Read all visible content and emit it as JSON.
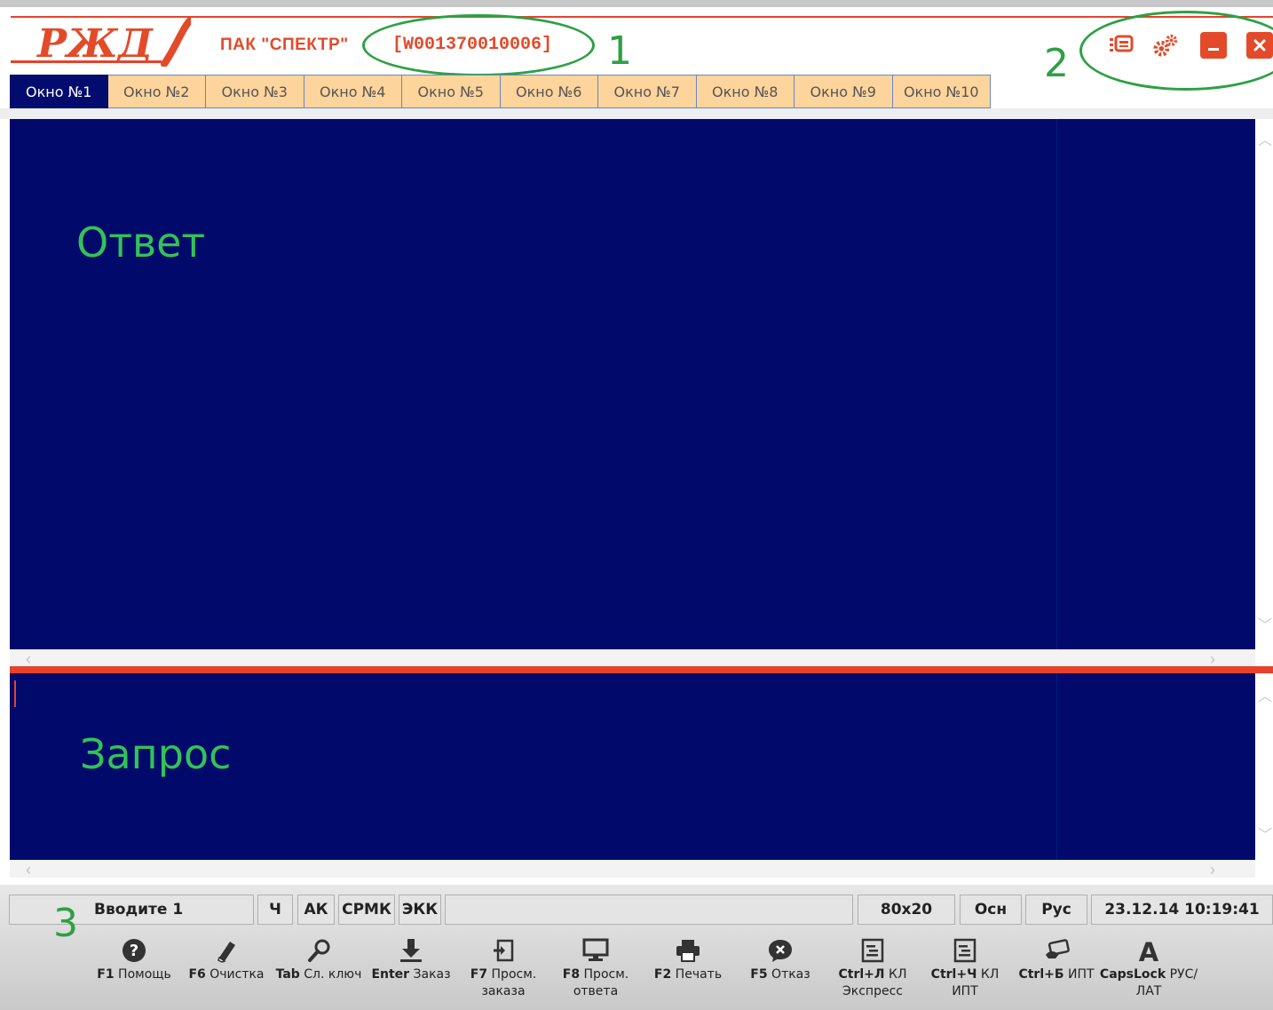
{
  "header": {
    "app_title": "ПАК \"СПЕКТР\"",
    "station_id": "[W001370010006]",
    "logo_text": "РЖД"
  },
  "annotations": [
    "1",
    "2",
    "3"
  ],
  "header_buttons": [
    {
      "name": "window-list-icon",
      "color": "#e34a2a"
    },
    {
      "name": "gears-icon",
      "color": "#e34a2a"
    },
    {
      "name": "minimize-icon",
      "color": "#e34a2a"
    },
    {
      "name": "close-icon",
      "color": "#e34a2a"
    }
  ],
  "tabs": [
    {
      "label": "Окно №1",
      "active": true
    },
    {
      "label": "Окно №2"
    },
    {
      "label": "Окно №3"
    },
    {
      "label": "Окно №4"
    },
    {
      "label": "Окно №5"
    },
    {
      "label": "Окно №6"
    },
    {
      "label": "Окно №7"
    },
    {
      "label": "Окно №8"
    },
    {
      "label": "Окно №9"
    },
    {
      "label": "Окно №10"
    }
  ],
  "panels": {
    "answer_label": "Ответ",
    "request_label": "Запрос"
  },
  "status_bar": {
    "input_status": "Вводите 1",
    "flag_ch": "Ч",
    "flag_ak": "АК",
    "flag_srmk": "СРМК",
    "flag_ekk": "ЭКК",
    "empty_field": "",
    "screen_size": "80x20",
    "mode": "Осн",
    "language": "Рус",
    "datetime": "23.12.14 10:19:41"
  },
  "function_keys": [
    {
      "key": "F1",
      "label": "Помощь",
      "label2": "",
      "icon": "help-icon"
    },
    {
      "key": "F6",
      "label": "Очистка",
      "label2": "",
      "icon": "eraser-icon"
    },
    {
      "key": "Tab",
      "label": "Сл. ключ",
      "label2": "",
      "icon": "search-key-icon"
    },
    {
      "key": "Enter",
      "label": "Заказ",
      "label2": "",
      "icon": "download-icon"
    },
    {
      "key": "F7",
      "label": "Просм.",
      "label2": "заказа",
      "icon": "view-order-icon"
    },
    {
      "key": "F8",
      "label": "Просм.",
      "label2": "ответа",
      "icon": "monitor-icon"
    },
    {
      "key": "F2",
      "label": "Печать",
      "label2": "",
      "icon": "printer-icon"
    },
    {
      "key": "F5",
      "label": "Отказ",
      "label2": "",
      "icon": "cancel-icon"
    },
    {
      "key": "Ctrl+Л",
      "label": "КЛ",
      "label2": "Экспресс",
      "icon": "document-icon"
    },
    {
      "key": "Ctrl+Ч",
      "label": "КЛ",
      "label2": "ИПТ",
      "icon": "document-icon"
    },
    {
      "key": "Ctrl+Б",
      "label": "ИПТ",
      "label2": "",
      "icon": "card-icon"
    },
    {
      "key": "CapsLock",
      "label": "РУС/",
      "label2": "ЛАТ",
      "icon": "letter-a-icon"
    }
  ],
  "colors": {
    "brand_red": "#e34a2a",
    "panel_navy": "#010a6b",
    "annotation_green": "#2ea043",
    "tab_inactive": "#fdd49c"
  }
}
